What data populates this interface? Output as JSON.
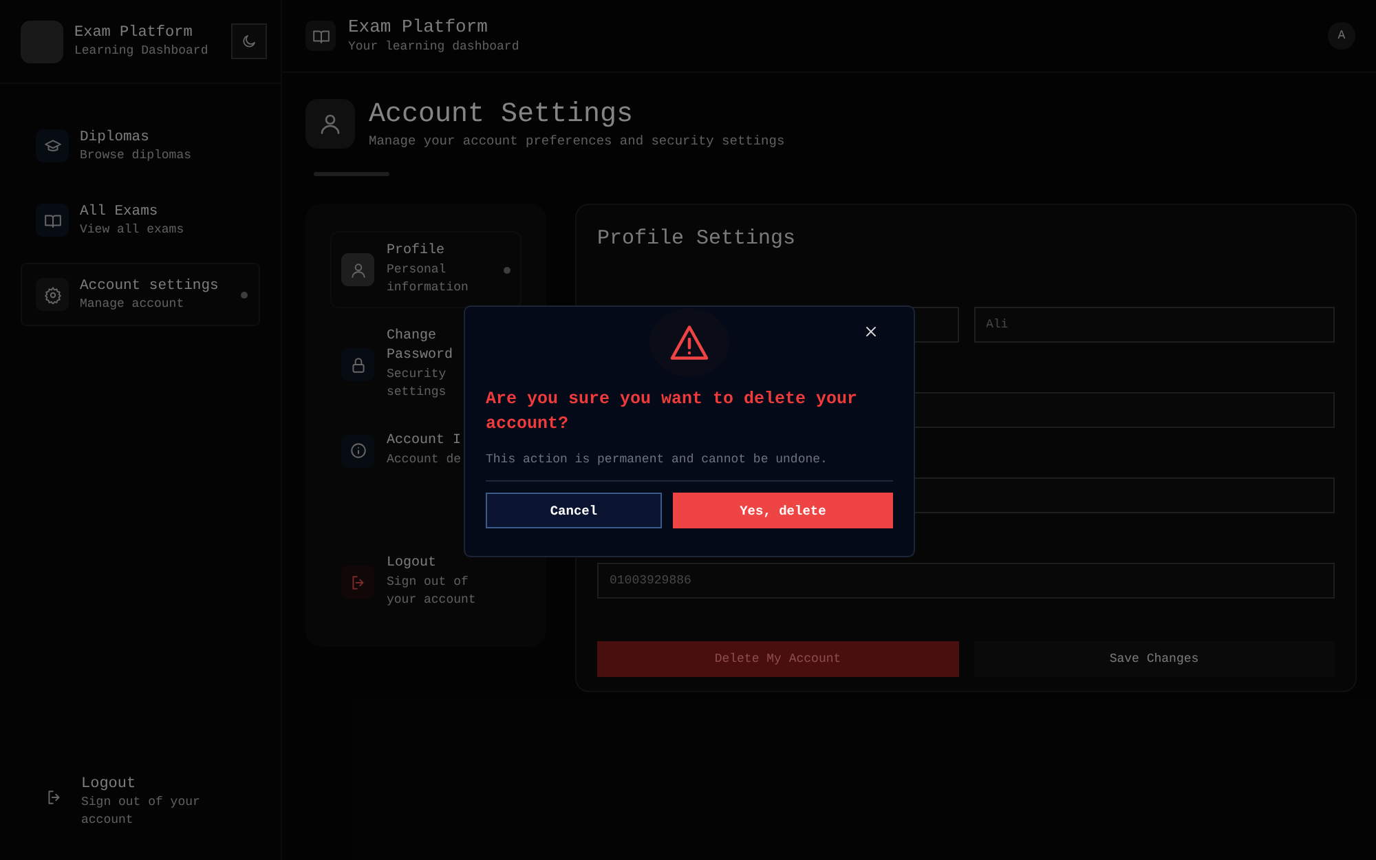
{
  "sidebar": {
    "brand": {
      "title": "Exam Platform",
      "subtitle": "Learning Dashboard"
    },
    "nav": [
      {
        "label": "Diplomas",
        "sublabel": "Browse diplomas",
        "selected": false
      },
      {
        "label": "All Exams",
        "sublabel": "View all exams",
        "selected": false
      },
      {
        "label": "Account settings",
        "sublabel": "Manage account",
        "selected": true
      }
    ],
    "logout": {
      "label": "Logout",
      "sublabel": "Sign out of your account"
    }
  },
  "header": {
    "title": "Exam Platform",
    "subtitle": "Your learning dashboard",
    "avatar": "A"
  },
  "page": {
    "title": "Account Settings",
    "subtitle": "Manage your account preferences and security settings"
  },
  "settings_menu": [
    {
      "kind": "tab",
      "label": "Profile",
      "sublabel": "Personal information",
      "selected": true
    },
    {
      "kind": "tab",
      "label": "Change Password",
      "sublabel": "Security settings",
      "selected": false
    },
    {
      "kind": "tab",
      "label": "Account I",
      "sublabel": "Account de",
      "selected": false
    },
    {
      "kind": "logout",
      "label": "Logout",
      "sublabel": "Sign out of your account",
      "selected": false
    }
  ],
  "profile": {
    "title": "Profile Settings",
    "rows": [
      [
        {
          "kind": "text"
        },
        {
          "kind": "text",
          "value": "Ali"
        }
      ],
      [
        {
          "kind": "text"
        }
      ],
      [
        {
          "kind": "text"
        }
      ],
      [
        {
          "kind": "text",
          "value": "01003929886"
        }
      ]
    ],
    "buttons": [
      {
        "kind": "danger",
        "label": "Delete My Account"
      },
      {
        "kind": "plain",
        "label": "Save Changes"
      }
    ]
  },
  "dialog": {
    "title": "Are you sure you want to delete your account?",
    "message": "This action is permanent and cannot be undone.",
    "buttons": [
      {
        "kind": "cancel",
        "label": "Cancel"
      },
      {
        "kind": "confirm",
        "label": "Yes, delete"
      }
    ]
  }
}
